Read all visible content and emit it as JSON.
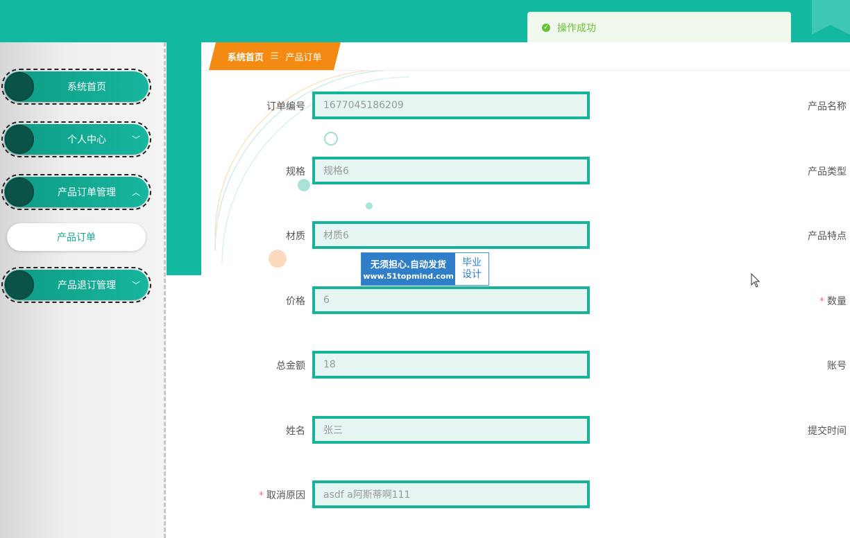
{
  "toast": {
    "message": "操作成功",
    "color": "#67c23a"
  },
  "sidebar": {
    "items": [
      {
        "label": "系统首页",
        "chevron": ""
      },
      {
        "label": "个人中心",
        "chevron": "﹀"
      },
      {
        "label": "产品订单管理",
        "chevron": "︿"
      },
      {
        "label": "产品退订管理",
        "chevron": "﹀"
      }
    ],
    "submenu": {
      "label": "产品订单"
    }
  },
  "breadcrumb": {
    "home": "系统首页",
    "separator": "☰",
    "current": "产品订单"
  },
  "form": {
    "left_fields": [
      {
        "label": "订单编号",
        "value": "1677045186209",
        "required": false
      },
      {
        "label": "规格",
        "value": "规格6",
        "required": false
      },
      {
        "label": "材质",
        "value": "材质6",
        "required": false
      },
      {
        "label": "价格",
        "value": "6",
        "required": false
      },
      {
        "label": "总金额",
        "value": "18",
        "required": false
      },
      {
        "label": "姓名",
        "value": "张三",
        "required": false
      },
      {
        "label": "取消原因",
        "value": "asdf a阿斯蒂啊111",
        "required": true,
        "required_mark": "*"
      }
    ],
    "right_labels": [
      {
        "label": "产品名称",
        "required": false
      },
      {
        "label": "产品类型",
        "required": false
      },
      {
        "label": "产品特点",
        "required": false
      },
      {
        "label": "数量",
        "required": true,
        "required_mark": "*"
      },
      {
        "label": "账号",
        "required": false
      },
      {
        "label": "提交时间",
        "required": false
      }
    ]
  },
  "watermark": {
    "main": "无须担心.自动发货",
    "url": "www.51topmind.com",
    "side_line1": "毕业",
    "side_line2": "设计"
  },
  "colors": {
    "primary": "#12b8a0",
    "breadcrumb": "#f48a12",
    "input_bg": "#e6f7f3",
    "input_border": "#17b29a"
  }
}
